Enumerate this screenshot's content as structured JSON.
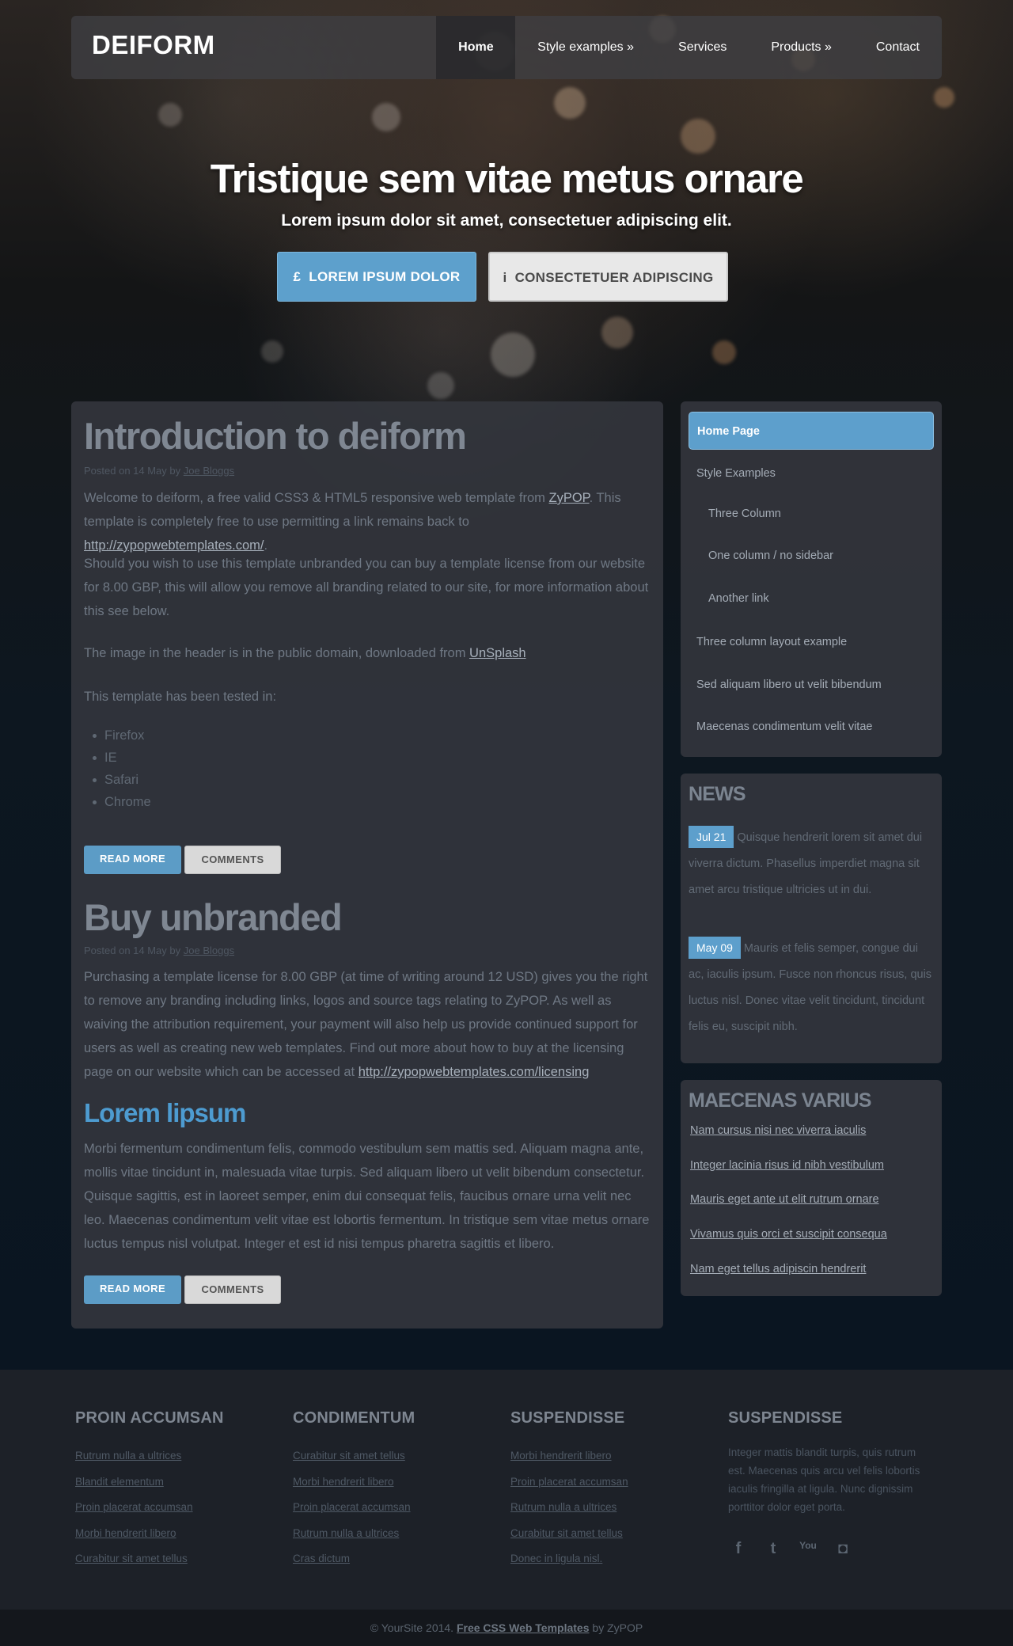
{
  "header": {
    "logo": "DEIFORM",
    "nav": [
      {
        "label": "Home",
        "active": true
      },
      {
        "label": "Style examples »"
      },
      {
        "label": "Services"
      },
      {
        "label": "Products »"
      },
      {
        "label": "Contact"
      }
    ]
  },
  "hero": {
    "title": "Tristique sem vitae metus ornare",
    "subtitle": "Lorem ipsum dolor sit amet, consectetuer adipiscing elit.",
    "button_primary": {
      "icon": "£",
      "label": "LOREM IPSUM DOLOR"
    },
    "button_secondary": {
      "icon": "i",
      "label": "CONSECTETUER ADIPISCING"
    }
  },
  "posts": {
    "intro": {
      "title": "Introduction to deiform",
      "meta_prefix": "Posted on 14 May by ",
      "meta_author": "Joe Bloggs",
      "p1_a": "Welcome to deiform, a free valid CSS3 & HTML5 responsive web template from ",
      "p1_link1": "ZyPOP",
      "p1_b": ". This template is completely free to use permitting a link remains back to ",
      "p1_link2": "http://zypopwebtemplates.com/",
      "p1_c": ".",
      "p2": "Should you wish to use this template unbranded you can buy a template license from our website for 8.00 GBP, this will allow you remove all branding related to our site, for more information about this see below.",
      "p3_a": "The image in the header is in the public domain, downloaded from ",
      "p3_link": "UnSplash",
      "p4": "This template has been tested in:",
      "browsers": [
        "Firefox",
        "IE",
        "Safari",
        "Chrome"
      ],
      "read_more": "READ MORE",
      "comments": "COMMENTS"
    },
    "unbranded": {
      "title": "Buy unbranded",
      "meta_prefix": "Posted on 14 May by ",
      "meta_author": "Joe Bloggs",
      "p1_a": "Purchasing a template license for 8.00 GBP (at time of writing around 12 USD) gives you the right to remove any branding including links, logos and source tags relating to ZyPOP. As well as waiving the attribution requirement, your payment will also help us provide continued support for users as well as creating new web templates. Find out more about how to buy at the licensing page on our website which can be accessed at ",
      "p1_link": "http://zypopwebtemplates.com/licensing"
    },
    "lorem": {
      "title": "Lorem lipsum",
      "p1": "Morbi fermentum condimentum felis, commodo vestibulum sem mattis sed. Aliquam magna ante, mollis vitae tincidunt in, malesuada vitae turpis. Sed aliquam libero ut velit bibendum consectetur. Quisque sagittis, est in laoreet semper, enim dui consequat felis, faucibus ornare urna velit nec leo. Maecenas condimentum velit vitae est lobortis fermentum. In tristique sem vitae metus ornare luctus tempus nisl volutpat. Integer et est id nisi tempus pharetra sagittis et libero.",
      "read_more": "READ MORE",
      "comments": "COMMENTS"
    }
  },
  "sidebar": {
    "menu": [
      {
        "label": "Home Page",
        "active": true
      },
      {
        "label": "Style Examples"
      },
      {
        "label": "Three Column",
        "sub": true
      },
      {
        "label": "One column / no sidebar",
        "sub": true
      },
      {
        "label": "Another link",
        "sub": true
      },
      {
        "label": "Three column layout example"
      },
      {
        "label": "Sed aliquam libero ut velit bibendum"
      },
      {
        "label": "Maecenas condimentum velit vitae"
      }
    ],
    "news": {
      "title": "NEWS",
      "items": [
        {
          "date": "Jul 21",
          "text": "Quisque hendrerit lorem sit amet dui viverra dictum. Phasellus imperdiet magna sit amet arcu tristique ultricies ut in dui."
        },
        {
          "date": "May 09",
          "text": "Mauris et felis semper, congue dui ac, iaculis ipsum. Fusce non rhoncus risus, quis luctus nisl. Donec vitae velit tincidunt, tincidunt felis eu, suscipit nibh."
        }
      ]
    },
    "maecenas": {
      "title": "MAECENAS VARIUS",
      "links": [
        "Nam cursus nisi nec viverra iaculis",
        "Integer lacinia risus id nibh vestibulum",
        "Mauris eget ante ut elit rutrum ornare",
        "Vivamus quis orci et suscipit consequa",
        "Nam eget tellus adipiscin hendrerit"
      ]
    }
  },
  "footer": {
    "columns": [
      {
        "title": "PROIN ACCUMSAN",
        "links": [
          "Rutrum nulla a ultrices",
          "Blandit elementum",
          "Proin placerat accumsan",
          "Morbi hendrerit libero",
          "Curabitur sit amet tellus"
        ]
      },
      {
        "title": "CONDIMENTUM",
        "links": [
          "Curabitur sit amet tellus",
          "Morbi hendrerit libero",
          "Proin placerat accumsan",
          "Rutrum nulla a ultrices",
          "Cras dictum"
        ]
      },
      {
        "title": "SUSPENDISSE",
        "links": [
          "Morbi hendrerit libero",
          "Proin placerat accumsan",
          "Rutrum nulla a ultrices",
          "Curabitur sit amet tellus",
          "Donec in ligula nisl."
        ]
      }
    ],
    "about": {
      "title": "SUSPENDISSE",
      "text": "Integer mattis blandit turpis, quis rutrum est. Maecenas quis arcu vel felis lobortis iaculis fringilla at ligula. Nunc dignissim porttitor dolor eget porta.",
      "social": [
        {
          "icon": "facebook-icon",
          "glyph": "f"
        },
        {
          "icon": "twitter-icon",
          "glyph": "t"
        },
        {
          "icon": "youtube-icon",
          "glyph": "You"
        },
        {
          "icon": "instagram-icon",
          "glyph": "◘"
        }
      ]
    },
    "copyright_a": "© YourSite 2014. ",
    "copyright_link": "Free CSS Web Templates",
    "copyright_b": " by ZyPOP"
  }
}
